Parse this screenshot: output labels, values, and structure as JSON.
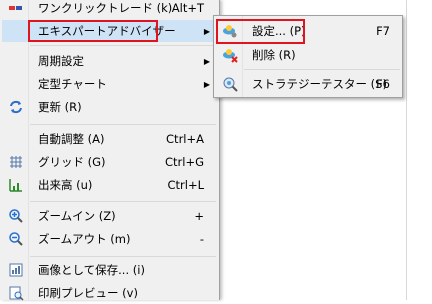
{
  "menu": {
    "one_click": {
      "label": "ワンクリックトレード (k)",
      "shortcut": "Alt+T"
    },
    "expert_advisor": {
      "label": "エキスパートアドバイザー"
    },
    "period": {
      "label": "周期設定"
    },
    "chart_template": {
      "label": "定型チャート"
    },
    "refresh": {
      "label": "更新 (R)"
    },
    "auto_scroll": {
      "label": "自動調整 (A)",
      "shortcut": "Ctrl+A"
    },
    "grid": {
      "label": "グリッド (G)",
      "shortcut": "Ctrl+G"
    },
    "volumes": {
      "label": "出来高 (u)",
      "shortcut": "Ctrl+L"
    },
    "zoom_in": {
      "label": "ズームイン (Z)",
      "shortcut": "+"
    },
    "zoom_out": {
      "label": "ズームアウト (m)",
      "shortcut": "-"
    },
    "save_image": {
      "label": "画像として保存... (i)"
    },
    "print_preview": {
      "label": "印刷プレビュー (v)"
    }
  },
  "submenu": {
    "settings": {
      "label": "設定... (P)",
      "shortcut": "F7"
    },
    "remove": {
      "label": "削除 (R)"
    },
    "strategy_tester": {
      "label": "ストラテジーテスター (S)",
      "shortcut": "F6"
    }
  },
  "colors": {
    "highlight": "#cfe3f7",
    "annotation_red": "#e0141e"
  }
}
